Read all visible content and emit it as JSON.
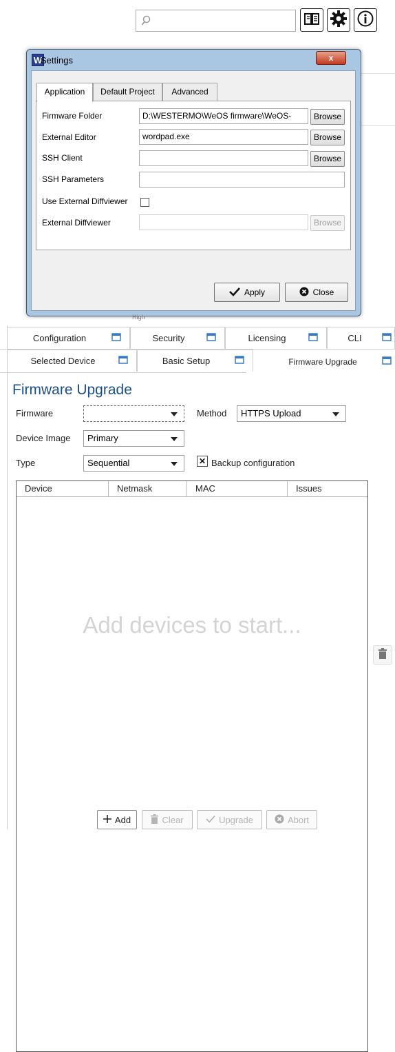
{
  "toolbar": {
    "search_placeholder": "",
    "icons": [
      "search-icon",
      "book-icon",
      "gear-icon",
      "info-icon"
    ]
  },
  "background": {
    "partial_text": "High"
  },
  "settings": {
    "title": "Settings",
    "close_label": "x",
    "tabs": [
      "Application",
      "Default Project",
      "Advanced"
    ],
    "active_tab": "Application",
    "fields": {
      "firmware_folder_label": "Firmware Folder",
      "firmware_folder_value": "D:\\WESTERMO\\WeOS firmware\\WeOS-",
      "external_editor_label": "External Editor",
      "external_editor_value": "wordpad.exe",
      "ssh_client_label": "SSH Client",
      "ssh_client_value": "",
      "ssh_parameters_label": "SSH Parameters",
      "ssh_parameters_value": "",
      "use_ext_diff_label": "Use External Diffviewer",
      "use_ext_diff_checked": false,
      "ext_diff_label": "External Diffviewer",
      "ext_diff_value": ""
    },
    "browse_label": "Browse",
    "apply_label": "Apply",
    "close_button_label": "Close"
  },
  "main_tabs_row1": [
    "Configuration",
    "Security",
    "Licensing",
    "CLI"
  ],
  "main_tabs_row2": [
    "Selected Device",
    "Basic Setup",
    "Firmware Upgrade"
  ],
  "active_main_tab": "Firmware Upgrade",
  "firmware_upgrade": {
    "title": "Firmware Upgrade",
    "firmware_label": "Firmware",
    "firmware_value": "",
    "method_label": "Method",
    "method_value": "HTTPS Upload",
    "device_image_label": "Device Image",
    "device_image_value": "Primary",
    "type_label": "Type",
    "type_value": "Sequential",
    "backup_label": "Backup configuration",
    "backup_checked": true,
    "backup_mark": "✕",
    "columns": [
      "Device",
      "Netmask",
      "MAC",
      "Issues"
    ],
    "placeholder": "Add devices to start...",
    "buttons": {
      "add": "Add",
      "clear": "Clear",
      "upgrade": "Upgrade",
      "abort": "Abort"
    }
  }
}
